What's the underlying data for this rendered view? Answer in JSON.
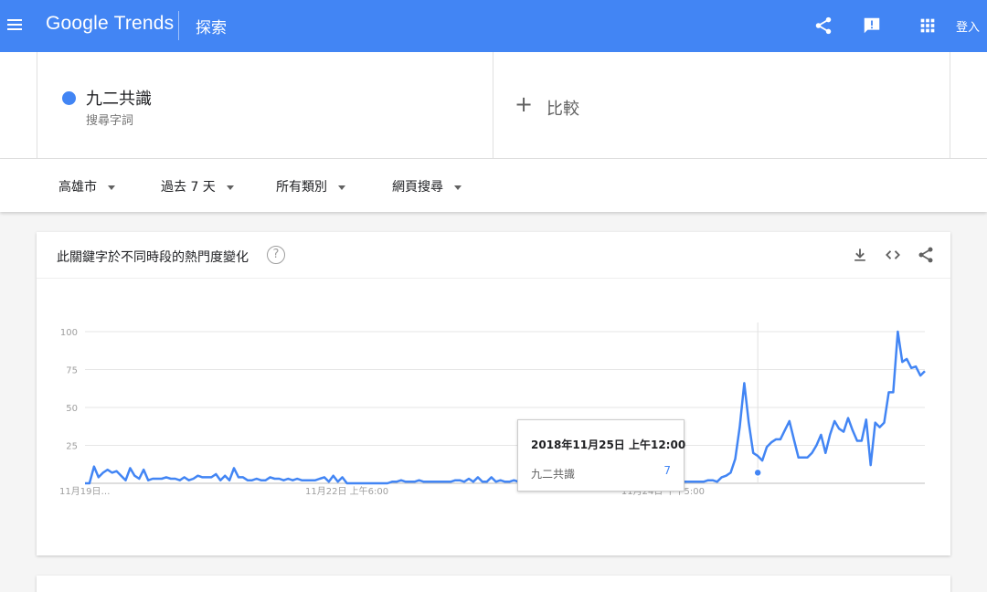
{
  "header": {
    "logo": "Google Trends",
    "section": "探索",
    "signin_label": "登入",
    "icons": [
      "menu-icon",
      "share-icon",
      "feedback-icon",
      "apps-icon"
    ]
  },
  "terms": {
    "term": "九二共識",
    "term_type": "搜尋字詞",
    "term_color": "#4285f4",
    "compare_plus": "+",
    "compare_label": "比較"
  },
  "filters": {
    "region": "高雄市",
    "time": "過去 7 天",
    "category": "所有類別",
    "search_type": "網頁搜尋"
  },
  "card": {
    "title": "此關鍵字於不同時段的熱門度變化",
    "help": "?",
    "icons": [
      "download-icon",
      "embed-icon",
      "share-icon"
    ]
  },
  "tooltip": {
    "date": "2018年11月25日 上午12:00",
    "term": "九二共識",
    "value": "7"
  },
  "chart_data": {
    "type": "line",
    "title": "",
    "xlabel": "",
    "ylabel": "",
    "ylim": [
      0,
      100
    ],
    "yticks": [
      25,
      50,
      75,
      100
    ],
    "xtick_labels": [
      "11月19日…",
      "11月22日 上午6:00",
      "11月24日 下午5:00"
    ],
    "xtick_index": [
      0,
      58,
      128
    ],
    "grid": true,
    "series": [
      {
        "name": "九二共識",
        "color": "#4285f4",
        "values": [
          0,
          0,
          11,
          4,
          7,
          9,
          7,
          8,
          5,
          2,
          10,
          5,
          3,
          9,
          2,
          3,
          3,
          3,
          4,
          3,
          3,
          2,
          4,
          2,
          3,
          5,
          4,
          4,
          4,
          6,
          2,
          5,
          2,
          10,
          4,
          4,
          2,
          2,
          3,
          2,
          2,
          4,
          3,
          3,
          2,
          3,
          2,
          3,
          2,
          2,
          2,
          2,
          3,
          4,
          1,
          5,
          1,
          4,
          0,
          0,
          0,
          0,
          0,
          0,
          0,
          0,
          0,
          0,
          1,
          1,
          2,
          1,
          1,
          1,
          2,
          1,
          1,
          1,
          1,
          1,
          1,
          1,
          2,
          2,
          1,
          3,
          1,
          4,
          1,
          1,
          4,
          1,
          2,
          1,
          1,
          2,
          1,
          1,
          1,
          1,
          2,
          2,
          2,
          1,
          1,
          1,
          1,
          1,
          2,
          1,
          1,
          2,
          2,
          2,
          3,
          1,
          1,
          1,
          1,
          6,
          1,
          1,
          1,
          1,
          1,
          2,
          1,
          2,
          1,
          1,
          1,
          1,
          1,
          1,
          1,
          1,
          1,
          1,
          2,
          2,
          1,
          4,
          5,
          7,
          16,
          37,
          66,
          40,
          20,
          18,
          15,
          24,
          27,
          29,
          29,
          35,
          41,
          29,
          17,
          17,
          17,
          20,
          25,
          32,
          20,
          32,
          41,
          36,
          34,
          43,
          35,
          28,
          28,
          42,
          12,
          40,
          37,
          40,
          60,
          60,
          100,
          80,
          82,
          76,
          77,
          71,
          74
        ]
      }
    ],
    "hover_index": 149,
    "hover_value": 7
  }
}
